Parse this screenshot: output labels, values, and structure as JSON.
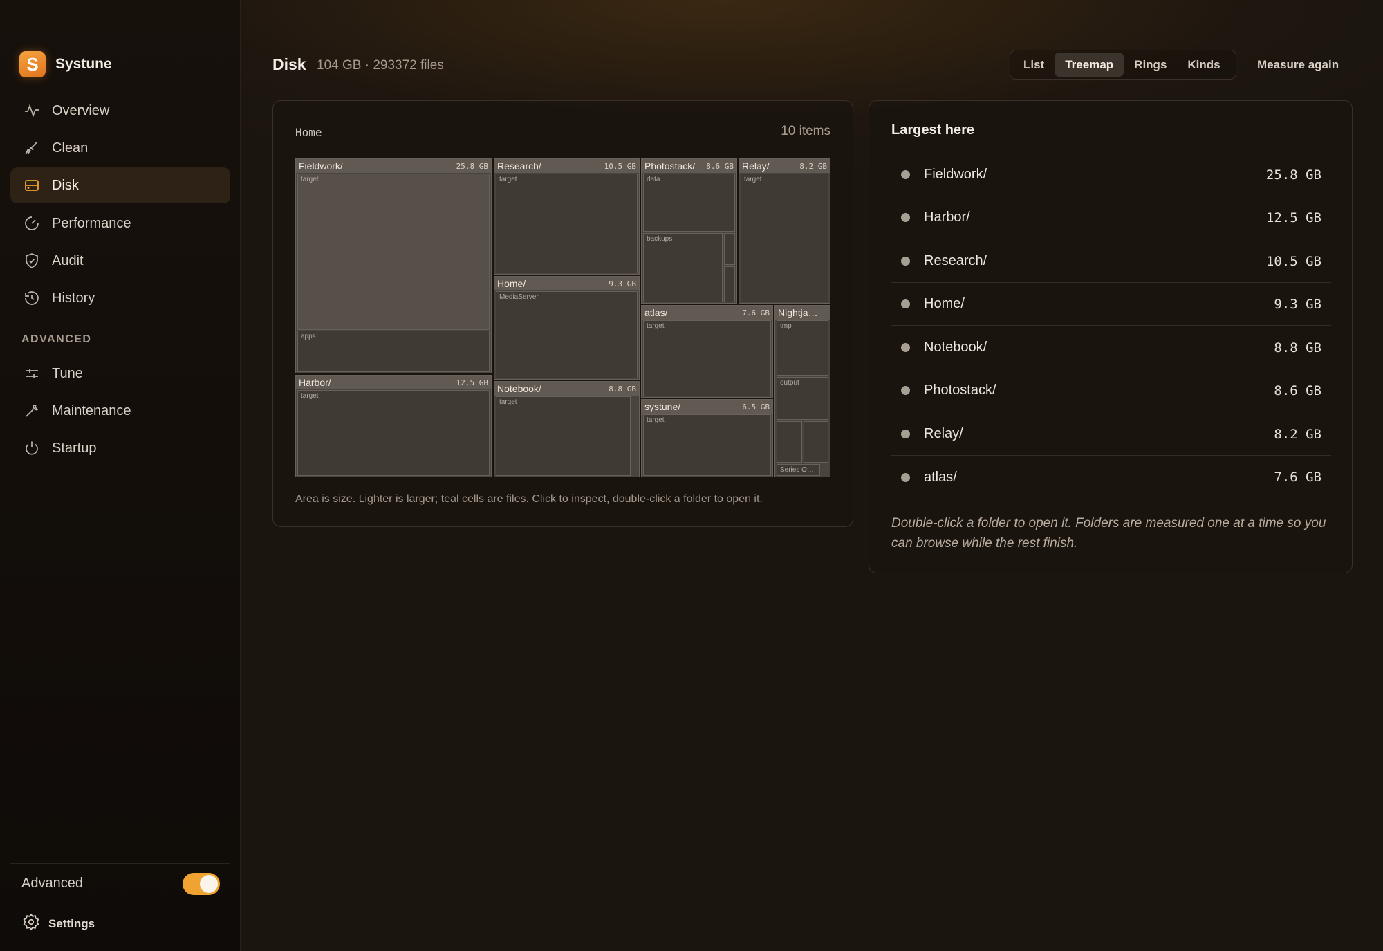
{
  "app": {
    "name": "Systune",
    "logo_letter": "S"
  },
  "sidebar": {
    "items": [
      {
        "label": "Overview",
        "icon": "activity-icon"
      },
      {
        "label": "Clean",
        "icon": "broom-icon"
      },
      {
        "label": "Disk",
        "icon": "disk-icon",
        "active": true
      },
      {
        "label": "Performance",
        "icon": "gauge-icon"
      },
      {
        "label": "Audit",
        "icon": "shield-check-icon"
      },
      {
        "label": "History",
        "icon": "history-icon"
      }
    ],
    "section_label": "ADVANCED",
    "advanced_items": [
      {
        "label": "Tune",
        "icon": "sliders-icon"
      },
      {
        "label": "Maintenance",
        "icon": "wrench-icon"
      },
      {
        "label": "Startup",
        "icon": "power-icon"
      }
    ],
    "advanced_toggle": {
      "label": "Advanced",
      "on": true
    },
    "settings_label": "Settings"
  },
  "header": {
    "title": "Disk",
    "subtitle": "104 GB · 293372 files",
    "views": [
      "List",
      "Treemap",
      "Rings",
      "Kinds"
    ],
    "active_view": "Treemap",
    "measure_label": "Measure again"
  },
  "treemap_panel": {
    "breadcrumb": "Home",
    "item_count": "10 items",
    "caption": "Area is size. Lighter is larger; teal cells are files. Click to inspect, double-click a folder to open it.",
    "cells": [
      {
        "name": "Fieldwork/",
        "size": "25.8 GB",
        "children": [
          "target",
          "apps"
        ]
      },
      {
        "name": "Harbor/",
        "size": "12.5 GB",
        "children": [
          "target"
        ]
      },
      {
        "name": "Research/",
        "size": "10.5 GB",
        "children": [
          "target"
        ]
      },
      {
        "name": "Home/",
        "size": "9.3 GB",
        "children": [
          "MediaServer"
        ]
      },
      {
        "name": "Notebook/",
        "size": "8.8 GB",
        "children": [
          "target"
        ]
      },
      {
        "name": "Photostack/",
        "size": "8.6 GB",
        "children": [
          "data",
          "backups"
        ]
      },
      {
        "name": "Relay/",
        "size": "8.2 GB",
        "children": [
          "target"
        ]
      },
      {
        "name": "atlas/",
        "size": "7.6 GB",
        "children": [
          "target"
        ]
      },
      {
        "name": "systune/",
        "size": "6.5 GB",
        "children": [
          "target"
        ]
      },
      {
        "name": "Nightja…",
        "size": "",
        "children": [
          "tmp",
          "output",
          "Series O…"
        ]
      }
    ]
  },
  "largest_panel": {
    "title": "Largest here",
    "rows": [
      {
        "name": "Fieldwork/",
        "size": "25.8 GB"
      },
      {
        "name": "Harbor/",
        "size": "12.5 GB"
      },
      {
        "name": "Research/",
        "size": "10.5 GB"
      },
      {
        "name": "Home/",
        "size": "9.3 GB"
      },
      {
        "name": "Notebook/",
        "size": "8.8 GB"
      },
      {
        "name": "Photostack/",
        "size": "8.6 GB"
      },
      {
        "name": "Relay/",
        "size": "8.2 GB"
      },
      {
        "name": "atlas/",
        "size": "7.6 GB"
      }
    ],
    "note": "Double-click a folder to open it. Folders are measured one at a time so you can browse while the rest finish."
  },
  "colors": {
    "accent": "#f0a330",
    "cell": "#4a443e",
    "cell_header": "#615a53"
  }
}
